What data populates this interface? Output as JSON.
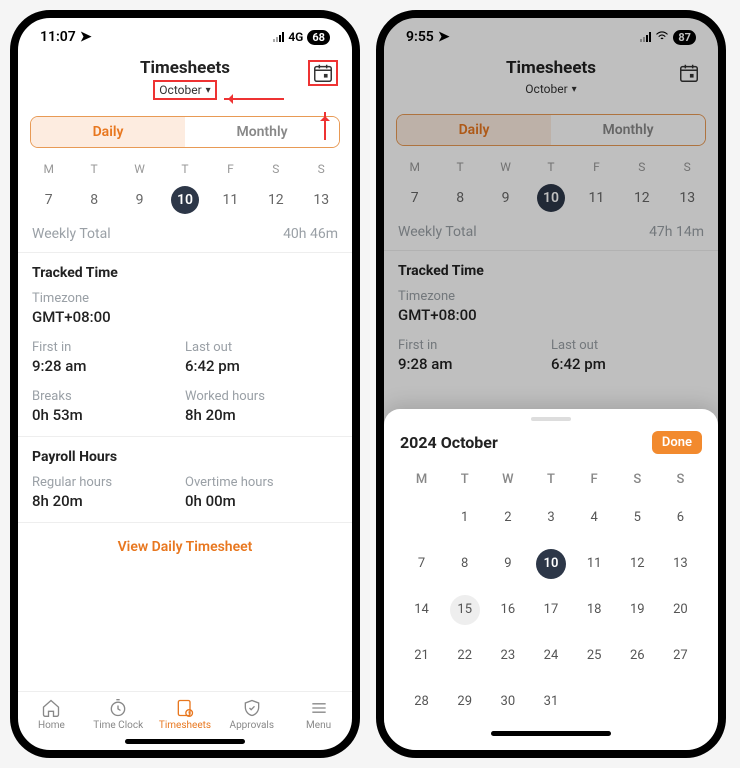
{
  "left": {
    "status": {
      "time": "11:07",
      "net": "4G",
      "battery": "68"
    },
    "header": {
      "title": "Timesheets",
      "month": "October"
    },
    "segmented": {
      "daily": "Daily",
      "monthly": "Monthly"
    },
    "week": {
      "labels": [
        "M",
        "T",
        "W",
        "T",
        "F",
        "S",
        "S"
      ],
      "nums": [
        "7",
        "8",
        "9",
        "10",
        "11",
        "12",
        "13"
      ],
      "selected_index": 3
    },
    "totals": {
      "label": "Weekly Total",
      "value": "40h 46m"
    },
    "tracked": {
      "title": "Tracked Time",
      "tz_label": "Timezone",
      "tz_value": "GMT+08:00",
      "first_in_label": "First in",
      "first_in_value": "9:28 am",
      "last_out_label": "Last out",
      "last_out_value": "6:42 pm",
      "breaks_label": "Breaks",
      "breaks_value": "0h 53m",
      "worked_label": "Worked hours",
      "worked_value": "8h 20m"
    },
    "payroll": {
      "title": "Payroll Hours",
      "regular_label": "Regular hours",
      "regular_value": "8h 20m",
      "ot_label": "Overtime hours",
      "ot_value": "0h 00m"
    },
    "view_link": "View Daily Timesheet",
    "tabs": {
      "home": "Home",
      "timeclock": "Time Clock",
      "timesheets": "Timesheets",
      "approvals": "Approvals",
      "menu": "Menu"
    }
  },
  "right": {
    "status": {
      "time": "9:55",
      "net": "",
      "battery": "87"
    },
    "header": {
      "title": "Timesheets",
      "month": "October"
    },
    "segmented": {
      "daily": "Daily",
      "monthly": "Monthly"
    },
    "week": {
      "labels": [
        "M",
        "T",
        "W",
        "T",
        "F",
        "S",
        "S"
      ],
      "nums": [
        "7",
        "8",
        "9",
        "10",
        "11",
        "12",
        "13"
      ],
      "selected_index": 3
    },
    "totals": {
      "label": "Weekly Total",
      "value": "47h 14m"
    },
    "tracked": {
      "title": "Tracked Time",
      "tz_label": "Timezone",
      "tz_value": "GMT+08:00",
      "first_in_label": "First in",
      "first_in_value": "9:28 am",
      "last_out_label": "Last out",
      "last_out_value": "6:42 pm"
    },
    "picker": {
      "title": "2024 October",
      "done": "Done",
      "headers": [
        "M",
        "T",
        "W",
        "T",
        "F",
        "S",
        "S"
      ],
      "days": [
        [
          "",
          "1",
          "2",
          "3",
          "4",
          "5",
          "6"
        ],
        [
          "7",
          "8",
          "9",
          "10",
          "11",
          "12",
          "13"
        ],
        [
          "14",
          "15",
          "16",
          "17",
          "18",
          "19",
          "20"
        ],
        [
          "21",
          "22",
          "23",
          "24",
          "25",
          "26",
          "27"
        ],
        [
          "28",
          "29",
          "30",
          "31",
          "",
          "",
          ""
        ]
      ],
      "selected": "10",
      "today": "15"
    }
  }
}
